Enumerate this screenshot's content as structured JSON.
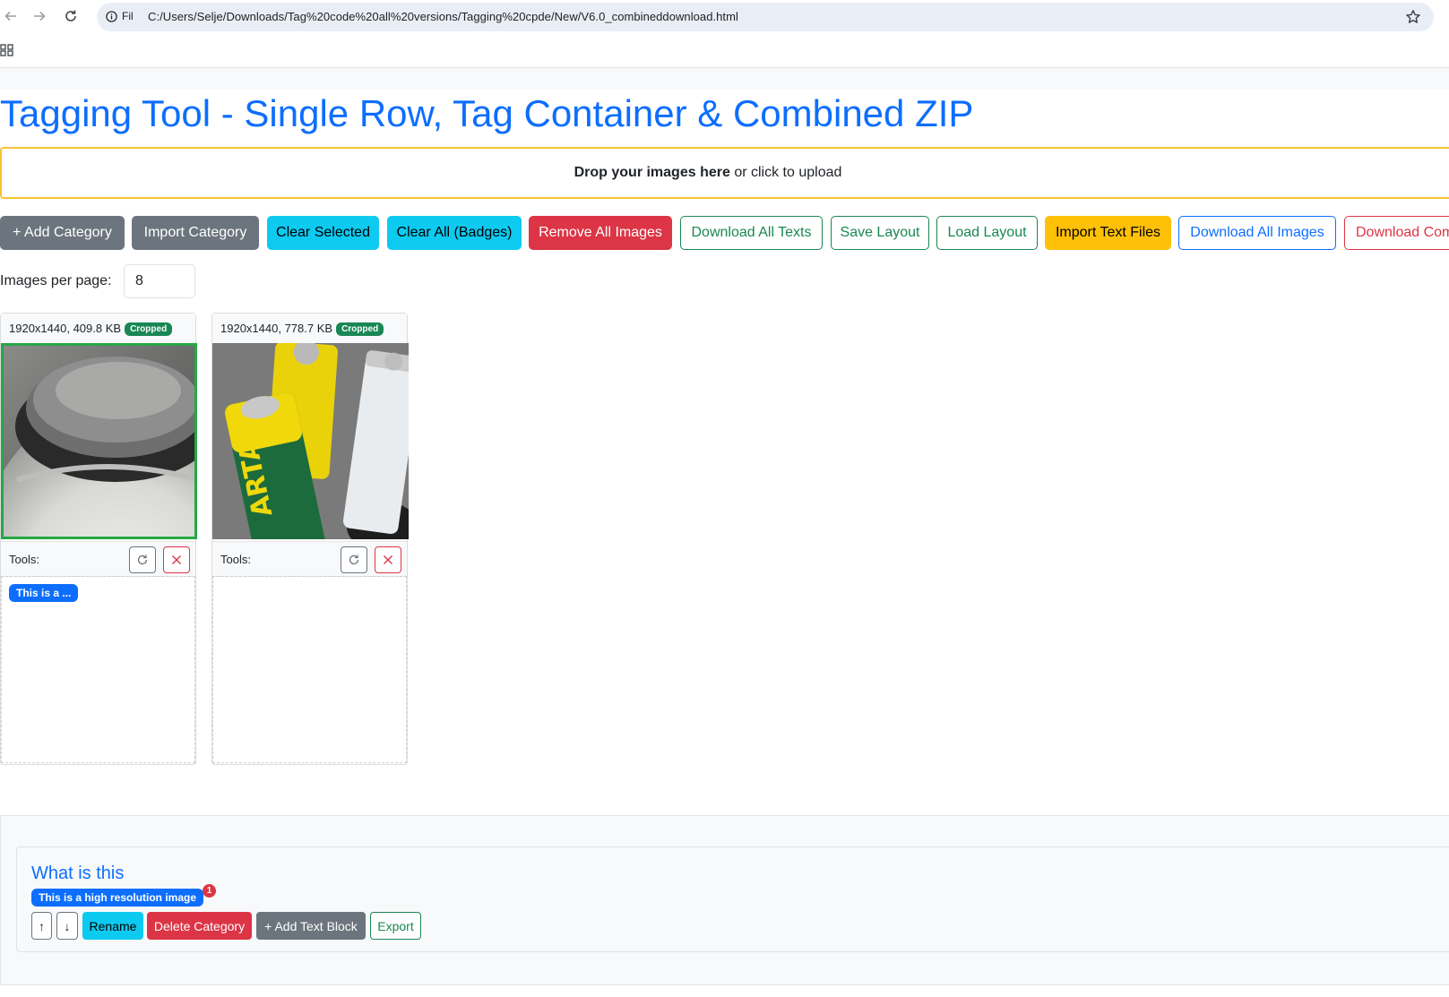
{
  "browser": {
    "url_scheme": "Fil",
    "url": "C:/Users/Selje/Downloads/Tag%20code%20all%20versions/Tagging%20cpde/New/V6.0_combineddownload.html"
  },
  "page": {
    "title": "Tagging Tool - Single Row, Tag Container & Combined ZIP",
    "dropzone_bold": "Drop your images here",
    "dropzone_rest": " or click to upload"
  },
  "toolbar": {
    "add_category": "+ Add Category",
    "import_category": "Import Category",
    "clear_selected": "Clear Selected",
    "clear_all_badges": "Clear All (Badges)",
    "remove_all_images": "Remove All Images",
    "download_all_texts": "Download All Texts",
    "save_layout": "Save Layout",
    "load_layout": "Load Layout",
    "import_text_files": "Import Text Files",
    "download_all_images": "Download All Images",
    "download_combined": "Download Com"
  },
  "pagination": {
    "label": "Images per page:",
    "value": "8"
  },
  "images": [
    {
      "info": "1920x1440, 409.8 KB",
      "badge": "Cropped",
      "tools_label": "Tools:",
      "tags": [
        "This is a ..."
      ],
      "selected": true
    },
    {
      "info": "1920x1440, 778.7 KB",
      "badge": "Cropped",
      "tools_label": "Tools:",
      "tags": [],
      "selected": false
    }
  ],
  "category": {
    "title": "What is this",
    "tag": "This is a high resolution image",
    "tag_count": "1",
    "buttons": {
      "up": "↑",
      "down": "↓",
      "rename": "Rename",
      "delete": "Delete Category",
      "add_text_block": "+ Add Text Block",
      "export": "Export"
    }
  },
  "colors": {
    "primary": "#0d6efd",
    "secondary": "#6c757d",
    "info": "#0dcaf0",
    "danger": "#dc3545",
    "success": "#198754",
    "warning": "#ffc107",
    "dropzone_border": "#f4c430"
  }
}
